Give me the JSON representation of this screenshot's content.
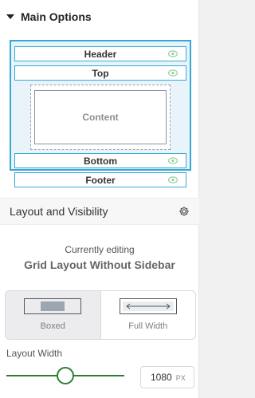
{
  "header": {
    "title": "Main Options"
  },
  "diagram": {
    "header_label": "Header",
    "top_label": "Top",
    "content_label": "Content",
    "bottom_label": "Bottom",
    "footer_label": "Footer"
  },
  "layout_visibility": {
    "label": "Layout and Visibility"
  },
  "editing": {
    "caption": "Currently editing",
    "layout_name": "Grid Layout Without Sidebar"
  },
  "options": [
    {
      "label": "Boxed",
      "selected": true
    },
    {
      "label": "Full Width",
      "selected": false
    }
  ],
  "layout_width": {
    "label": "Layout Width",
    "value": "1080",
    "unit": "PX",
    "slider_fraction": 0.5
  },
  "colors": {
    "accent": "#35a9d6",
    "slider": "#2e7d32",
    "eye": "#8fd19e"
  }
}
